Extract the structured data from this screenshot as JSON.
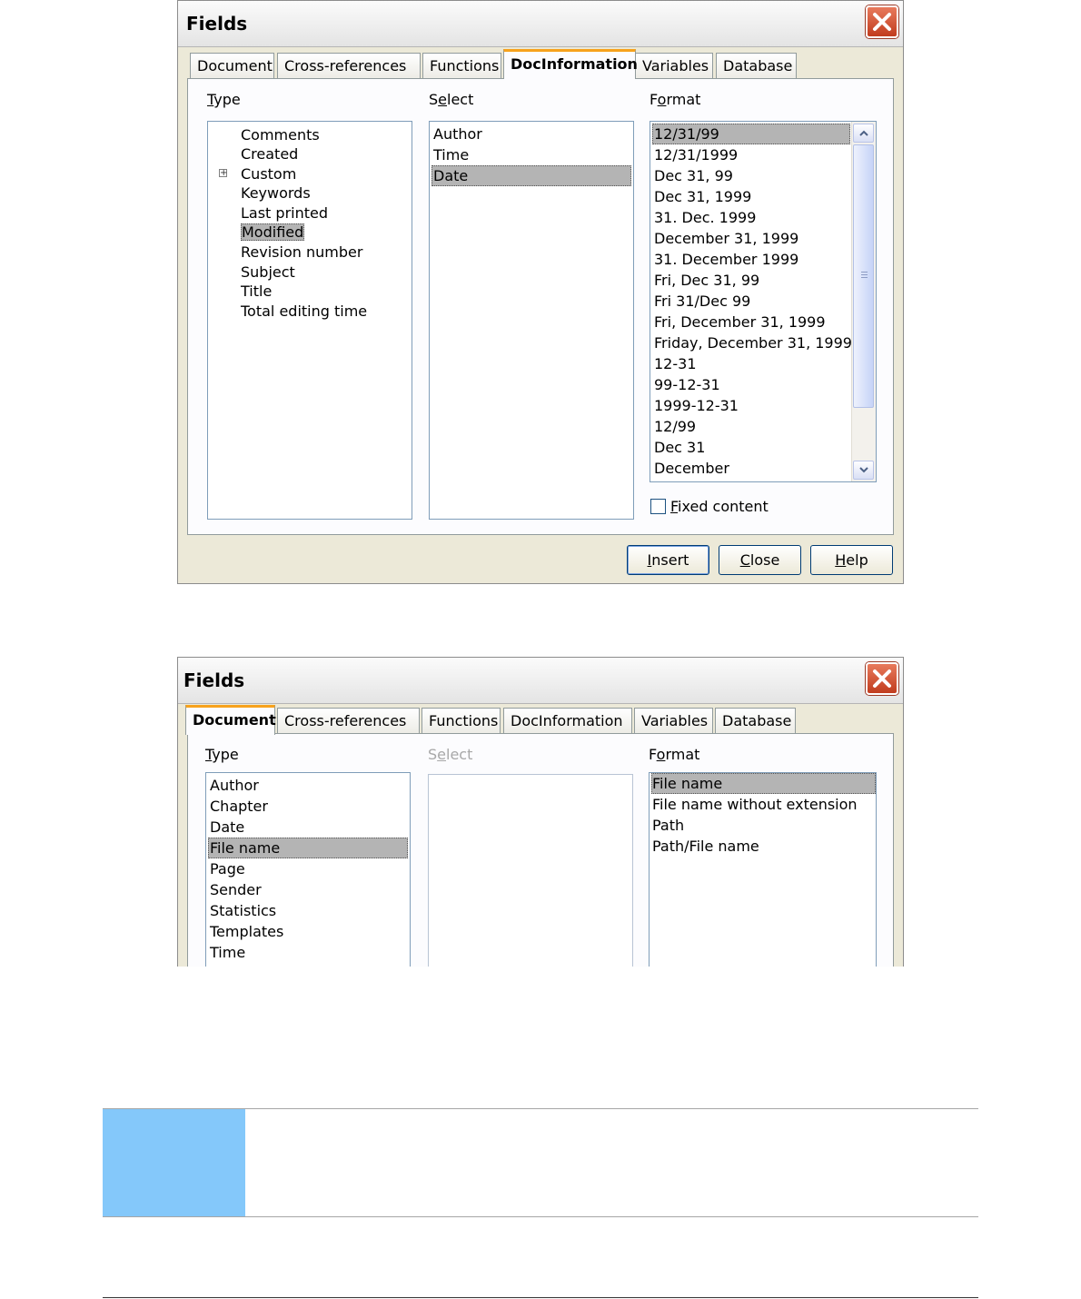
{
  "dialog1": {
    "title": "Fields",
    "tabs": [
      "Document",
      "Cross-references",
      "Functions",
      "DocInformation",
      "Variables",
      "Database"
    ],
    "active_tab": "DocInformation",
    "type_label": {
      "first": "T",
      "rest": "ype"
    },
    "select_label": {
      "before": "S",
      "mnemonic": "e",
      "after": "lect"
    },
    "format_label": {
      "before": "F",
      "mnemonic": "o",
      "after": "rmat"
    },
    "type_items": [
      "Comments",
      "Created",
      "Custom",
      "Keywords",
      "Last printed",
      "Modified",
      "Revision number",
      "Subject",
      "Title",
      "Total editing time"
    ],
    "type_selected": "Modified",
    "type_expandable": "Custom",
    "select_items": [
      "Author",
      "Time",
      "Date"
    ],
    "select_selected": "Date",
    "format_items": [
      "12/31/99",
      "12/31/1999",
      "Dec 31, 99",
      "Dec 31, 1999",
      "31. Dec. 1999",
      "December 31, 1999",
      "31. December 1999",
      "Fri, Dec 31, 99",
      "Fri 31/Dec 99",
      "Fri, December 31, 1999",
      "Friday, December 31, 1999",
      "12-31",
      "99-12-31",
      "1999-12-31",
      "12/99",
      "Dec 31",
      "December"
    ],
    "format_selected": "12/31/99",
    "fixed_content": {
      "mnemonic": "F",
      "rest": "ixed content",
      "checked": false
    },
    "buttons": {
      "insert": {
        "mnemonic": "I",
        "rest": "nsert"
      },
      "close": {
        "mnemonic": "C",
        "rest": "lose"
      },
      "help": {
        "mnemonic": "H",
        "rest": "elp"
      }
    }
  },
  "dialog2": {
    "title": "Fields",
    "tabs": [
      "Document",
      "Cross-references",
      "Functions",
      "DocInformation",
      "Variables",
      "Database"
    ],
    "active_tab": "Document",
    "type_label": {
      "first": "T",
      "rest": "ype"
    },
    "select_label": {
      "before": "S",
      "mnemonic": "e",
      "after": "lect"
    },
    "format_label": {
      "before": "F",
      "mnemonic": "o",
      "after": "rmat"
    },
    "type_items": [
      "Author",
      "Chapter",
      "Date",
      "File name",
      "Page",
      "Sender",
      "Statistics",
      "Templates",
      "Time"
    ],
    "type_selected": "File name",
    "format_items": [
      "File name",
      "File name without extension",
      "Path",
      "Path/File name"
    ],
    "format_selected": "File name"
  },
  "colors": {
    "tab_accent": "#f7a21c",
    "selection": "#b4b4b4",
    "close_button": "#c13c1e",
    "note_bar": "#84c8fa"
  },
  "icons": [
    "close-icon",
    "expand-plus-icon",
    "scroll-up-arrow-icon",
    "scroll-down-arrow-icon",
    "scroll-grip-icon"
  ]
}
